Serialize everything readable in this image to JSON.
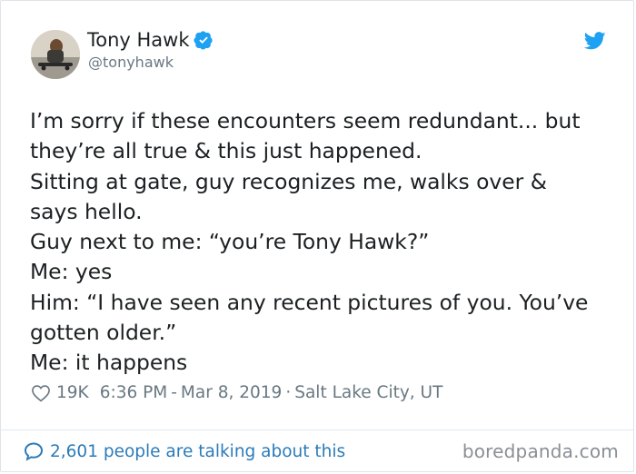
{
  "author": {
    "name": "Tony Hawk",
    "handle": "@tonyhawk",
    "verified": true,
    "avatar_icon": "avatar-photo"
  },
  "brand_icon": "twitter-bird-icon",
  "tweet": {
    "lines": [
      "I’m sorry if these encounters seem redundant... but",
      "they’re all true & this just happened.",
      "Sitting at gate, guy recognizes me, walks over &",
      "says hello.",
      "Guy next to me: “you’re Tony Hawk?”",
      "Me: yes",
      "Him: “I have seen any recent pictures of you. You’ve",
      "gotten older.”",
      "Me: it happens"
    ]
  },
  "meta": {
    "likes": "19K",
    "time": "6:36 PM",
    "separator_dash": "-",
    "date": "Mar 8, 2019",
    "separator_dot": "·",
    "location": "Salt Lake City, UT"
  },
  "footer": {
    "talking_text": "2,601 people are talking about this",
    "watermark": "boredpanda.com"
  },
  "colors": {
    "link": "#2b7bb9",
    "twitter_blue": "#1da1f2",
    "muted": "#697882"
  }
}
